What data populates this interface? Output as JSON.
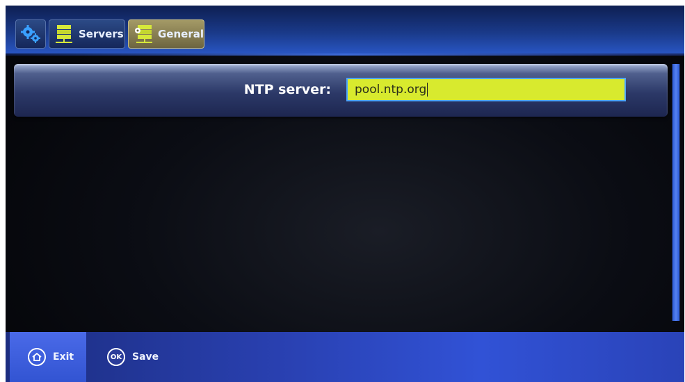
{
  "tabs": [
    {
      "icon": "gears-icon",
      "label": ""
    },
    {
      "icon": "server-icon",
      "label": "Servers"
    },
    {
      "icon": "server-settings-icon",
      "label": "General"
    }
  ],
  "settings": {
    "ntp_label": "NTP server:",
    "ntp_value": "pool.ntp.org"
  },
  "footer": {
    "exit_label": "Exit",
    "save_label": "Save",
    "ok_glyph": "OK"
  },
  "colors": {
    "input_background": "#d8ea2e",
    "active_tab": "#a49a66",
    "bar_blue": "#2940b0"
  }
}
